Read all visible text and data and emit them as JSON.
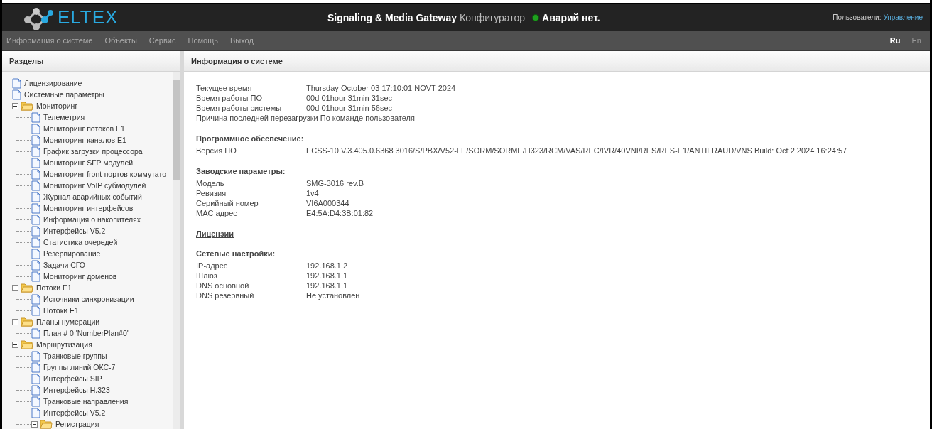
{
  "header": {
    "logo": "ELTEX",
    "title": "Signaling & Media Gateway",
    "subtitle": "Конфигуратор",
    "alarm": {
      "text": "Аварий нет.",
      "color": "#1fa01f"
    },
    "users_label": "Пользователи:",
    "users_link": "Управление"
  },
  "menu": [
    "Информация о системе",
    "Объекты",
    "Сервис",
    "Помощь",
    "Выход"
  ],
  "languages": [
    {
      "label": "Ru",
      "selected": true
    },
    {
      "label": "En",
      "selected": false
    }
  ],
  "sidebar": {
    "title": "Разделы",
    "tree": [
      {
        "kind": "file",
        "label": "Лицензирование"
      },
      {
        "kind": "file",
        "label": "Системные параметры"
      },
      {
        "kind": "folder",
        "label": "Мониторинг",
        "expanded": true,
        "children": [
          {
            "kind": "file",
            "label": "Телеметрия"
          },
          {
            "kind": "file",
            "label": "Мониторинг потоков E1"
          },
          {
            "kind": "file",
            "label": "Мониторинг каналов E1"
          },
          {
            "kind": "file",
            "label": "График загрузки процессора"
          },
          {
            "kind": "file",
            "label": "Мониторинг SFP модулей"
          },
          {
            "kind": "file",
            "label": "Мониторинг front-портов коммутато"
          },
          {
            "kind": "file",
            "label": "Мониторинг VoIP субмодулей"
          },
          {
            "kind": "file",
            "label": "Журнал аварийных событий"
          },
          {
            "kind": "file",
            "label": "Мониторинг интерфейсов"
          },
          {
            "kind": "file",
            "label": "Информация о накопителях"
          },
          {
            "kind": "file",
            "label": "Интерфейсы V5.2"
          },
          {
            "kind": "file",
            "label": "Статистика очередей"
          },
          {
            "kind": "file",
            "label": "Резервирование"
          },
          {
            "kind": "file",
            "label": "Задачи СГО"
          },
          {
            "kind": "file",
            "label": "Мониторинг доменов"
          }
        ]
      },
      {
        "kind": "folder",
        "label": "Потоки E1",
        "expanded": true,
        "children": [
          {
            "kind": "file",
            "label": "Источники синхронизации"
          },
          {
            "kind": "file",
            "label": "Потоки E1"
          }
        ]
      },
      {
        "kind": "folder",
        "label": "Планы нумерации",
        "expanded": true,
        "children": [
          {
            "kind": "file",
            "label": "План # 0 'NumberPlan#0'"
          }
        ]
      },
      {
        "kind": "folder",
        "label": "Маршрутизация",
        "expanded": true,
        "children": [
          {
            "kind": "file",
            "label": "Транковые группы"
          },
          {
            "kind": "file",
            "label": "Группы линий ОКС-7"
          },
          {
            "kind": "file",
            "label": "Интерфейсы SIP"
          },
          {
            "kind": "file",
            "label": "Интерфейсы H.323"
          },
          {
            "kind": "file",
            "label": "Транковые направления"
          },
          {
            "kind": "file",
            "label": "Интерфейсы V5.2"
          },
          {
            "kind": "folder",
            "label": "Регистрация",
            "expanded": true
          }
        ]
      }
    ]
  },
  "content": {
    "title": "Информация о системе",
    "sections": [
      {
        "rows": [
          {
            "label": "Текущее время",
            "value": "Thursday October 03 17:10:01 NOVT 2024"
          },
          {
            "label": "Время работы ПО",
            "value": "00d 01hour 31min 31sec"
          },
          {
            "label": "Время работы системы",
            "value": "00d 01hour 31min 56sec"
          },
          {
            "label": "Причина последней перезагрузки",
            "value": "По команде пользователя"
          }
        ]
      },
      {
        "heading": "Программное обеспечение:",
        "rows": [
          {
            "label": "Версия ПО",
            "value": "ECSS-10 V.3.405.0.6368 3016/S/PBX/V52-LE/SORM/SORME/H323/RCM/VAS/REC/IVR/40VNI/RES/RES-E1/ANTIFRAUD/VNS Build: Oct 2 2024 16:24:57"
          }
        ]
      },
      {
        "heading": "Заводские параметры:",
        "rows": [
          {
            "label": "Модель",
            "value": "SMG-3016 rev.B"
          },
          {
            "label": "Ревизия",
            "value": "1v4"
          },
          {
            "label": "Серийный номер",
            "value": "VI6A000344"
          },
          {
            "label": "MAC адрес",
            "value": "E4:5A:D4:3B:01:82"
          }
        ]
      },
      {
        "link": "Лицензии"
      },
      {
        "heading": "Сетевые настройки:",
        "rows": [
          {
            "label": "IP-адрес",
            "value": "192.168.1.2"
          },
          {
            "label": "Шлюз",
            "value": "192.168.1.1"
          },
          {
            "label": "DNS основной",
            "value": "192.168.1.1"
          },
          {
            "label": "DNS резервный",
            "value": "Не установлен"
          }
        ]
      }
    ]
  }
}
